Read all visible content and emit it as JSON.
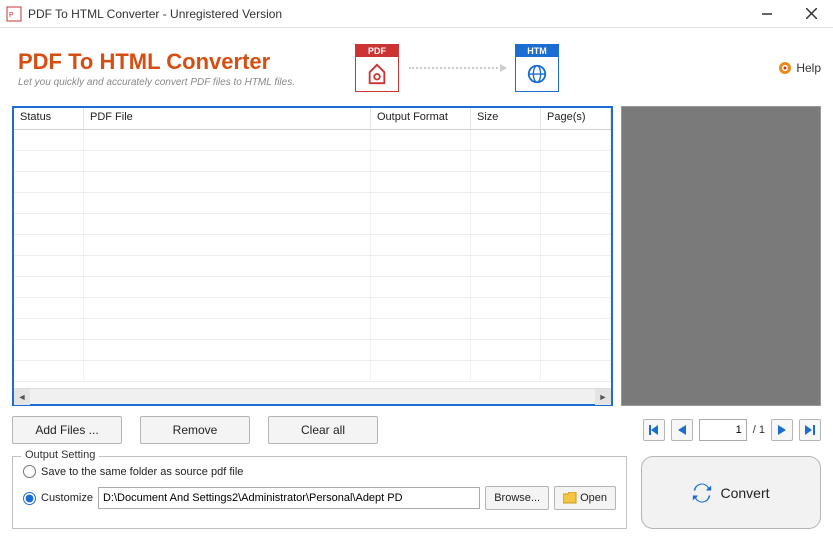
{
  "window": {
    "title": "PDF To HTML Converter - Unregistered Version"
  },
  "header": {
    "app_title": "PDF To HTML Converter",
    "subtitle": "Let you quickly and accurately convert PDF files to HTML files.",
    "pdf_label": "PDF",
    "htm_label": "HTM",
    "help_label": "Help"
  },
  "grid": {
    "columns": {
      "status": "Status",
      "file": "PDF File",
      "format": "Output Format",
      "size": "Size",
      "pages": "Page(s)"
    }
  },
  "buttons": {
    "add_files": "Add Files ...",
    "remove": "Remove",
    "clear_all": "Clear all",
    "browse": "Browse...",
    "open": "Open",
    "convert": "Convert"
  },
  "pager": {
    "current": "1",
    "total": "/ 1"
  },
  "output": {
    "legend": "Output Setting",
    "same_folder_label": "Save to the same folder as source pdf file",
    "customize_label": "Customize",
    "path": "D:\\Document And Settings2\\Administrator\\Personal\\Adept PD"
  }
}
